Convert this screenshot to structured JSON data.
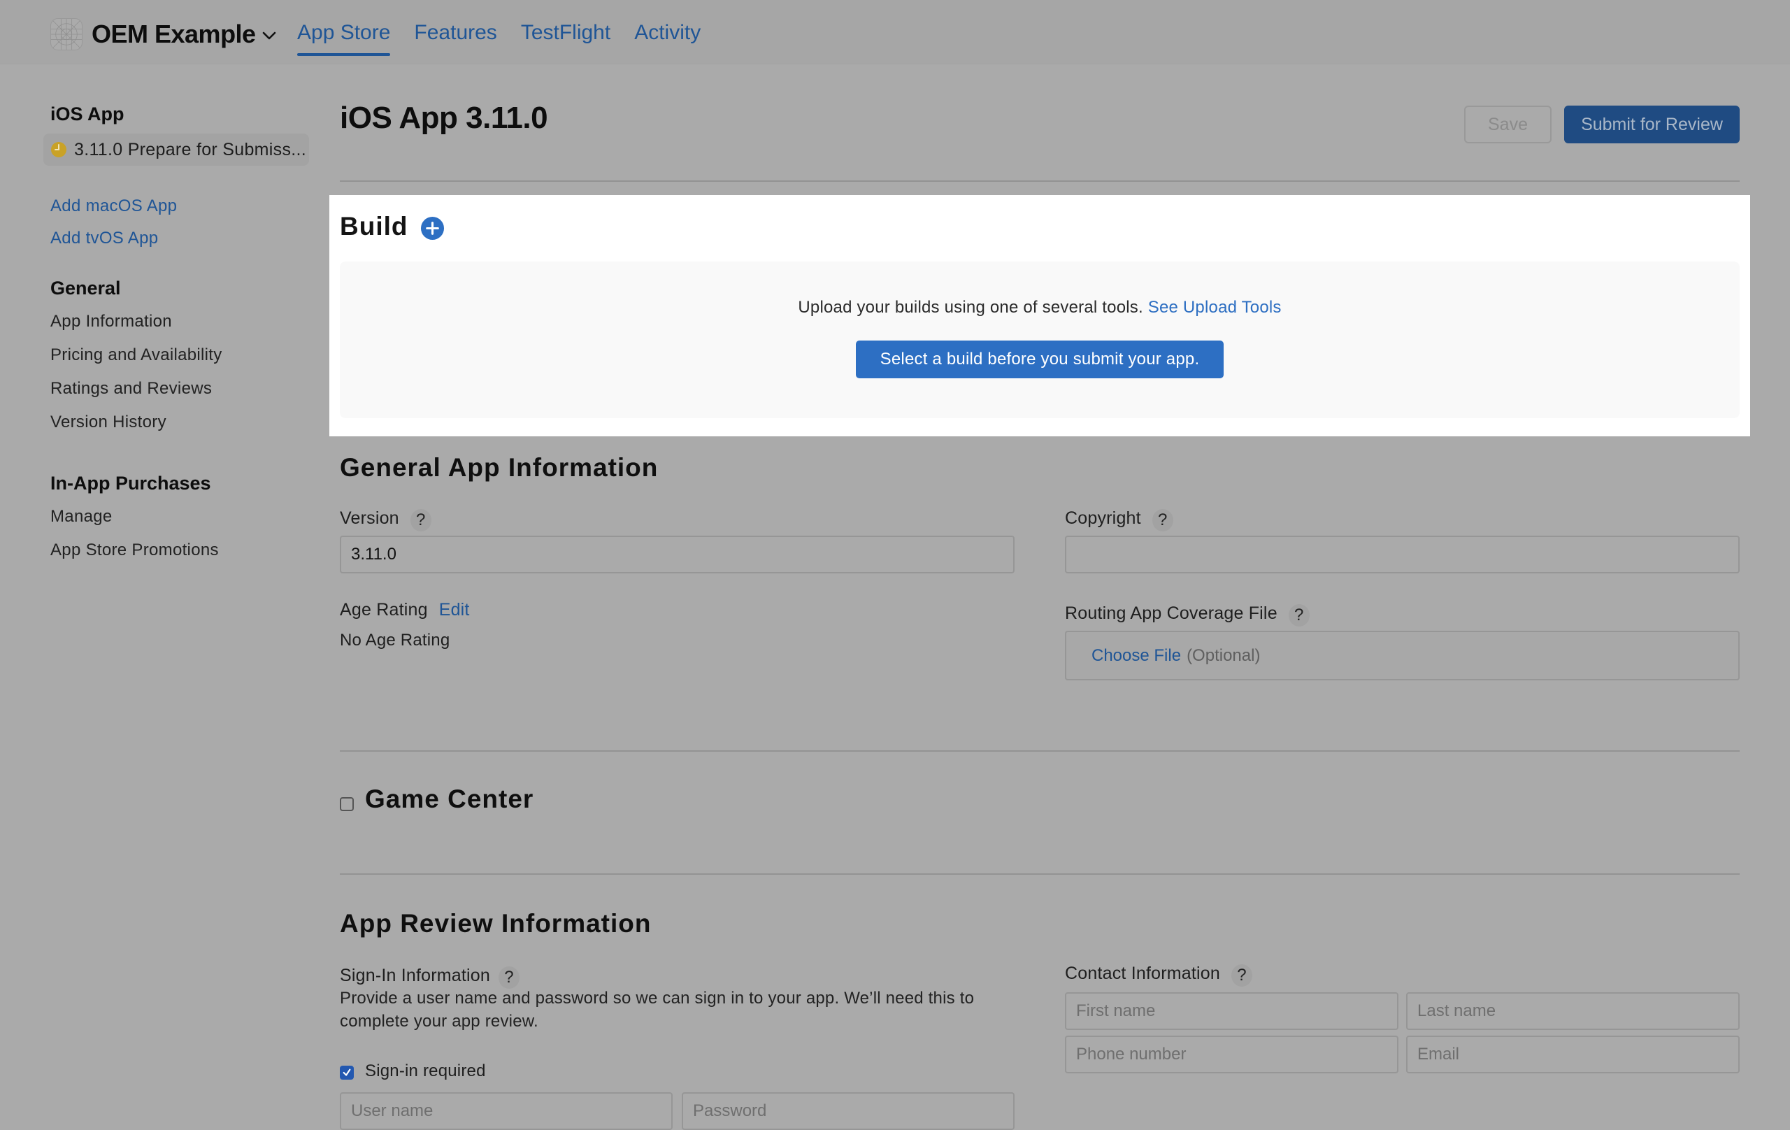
{
  "header": {
    "app_name": "OEM Example",
    "icon": "app-icon-placeholder",
    "dropdown_icon": "chevron-down-icon",
    "tabs": [
      {
        "label": "App Store",
        "active": true
      },
      {
        "label": "Features",
        "active": false
      },
      {
        "label": "TestFlight",
        "active": false
      },
      {
        "label": "Activity",
        "active": false
      }
    ]
  },
  "sidebar": {
    "platform_heading": "iOS App",
    "version_item": {
      "label": "3.11.0 Prepare for Submiss...",
      "status_icon": "clock-icon",
      "status_color": "#c9a227"
    },
    "add_links": [
      "Add macOS App",
      "Add tvOS App"
    ],
    "sections": [
      {
        "heading": "General",
        "items": [
          "App Information",
          "Pricing and Availability",
          "Ratings and Reviews",
          "Version History"
        ]
      },
      {
        "heading": "In-App Purchases",
        "items": [
          "Manage",
          "App Store Promotions"
        ]
      }
    ]
  },
  "page": {
    "title": "iOS App 3.11.0",
    "save_label": "Save",
    "submit_label": "Submit for Review"
  },
  "build": {
    "title": "Build",
    "add_icon": "plus-circle-icon",
    "upload_text": "Upload your builds using one of several tools.",
    "upload_link": "See Upload Tools",
    "select_button": "Select a build before you submit your app."
  },
  "general_info": {
    "title": "General App Information",
    "version_label": "Version",
    "version_value": "3.11.0",
    "copyright_label": "Copyright",
    "copyright_value": "",
    "age_rating_label": "Age Rating",
    "age_rating_edit": "Edit",
    "age_rating_value": "No Age Rating",
    "routing_label": "Routing App Coverage File",
    "choose_file": "Choose File",
    "optional": "(Optional)",
    "help_glyph": "?"
  },
  "game_center": {
    "title": "Game Center",
    "checked": false
  },
  "review_info": {
    "title": "App Review Information",
    "signin_label": "Sign-In Information",
    "signin_desc": "Provide a user name and password so we can sign in to your app. We’ll need this to complete your app review.",
    "signin_required_label": "Sign-in required",
    "signin_required_checked": true,
    "username_placeholder": "User name",
    "password_placeholder": "Password",
    "contact_label": "Contact Information",
    "first_name_placeholder": "First name",
    "last_name_placeholder": "Last name",
    "phone_placeholder": "Phone number",
    "email_placeholder": "Email"
  },
  "colors": {
    "link": "#1f5596",
    "primary_button": "#2d6fc3",
    "overlay_bg": "#aaaaaa",
    "spotlight_bg": "#ffffff"
  }
}
